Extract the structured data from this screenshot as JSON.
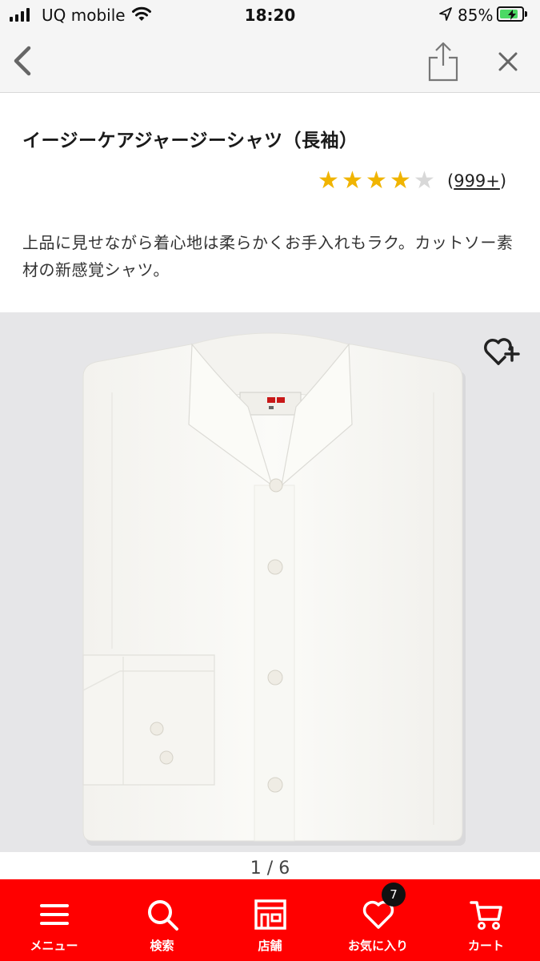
{
  "status_bar": {
    "carrier": "UQ mobile",
    "time": "18:20",
    "battery_percent": "85%",
    "battery_level": 0.85,
    "icons": [
      "signal-icon",
      "wifi-icon",
      "location-arrow-icon",
      "battery-charging-icon"
    ]
  },
  "nav": {
    "icons": [
      "back-chevron-icon",
      "share-icon",
      "close-icon"
    ]
  },
  "product": {
    "title": "イージーケアジャージーシャツ（長袖）",
    "rating_value": 4,
    "rating_max": 5,
    "review_count_open": "(",
    "review_count": "999+",
    "review_count_close": ")",
    "description": "上品に見せながら着心地は柔らかくお手入れもラク。カットソー素材の新感覚シャツ。"
  },
  "gallery": {
    "pager": "1 / 6",
    "current": 1,
    "total": 6,
    "image_subject": "white-dress-shirt-photo",
    "favorite_icon": "heart-plus-icon"
  },
  "tab_bar": {
    "items": [
      {
        "label": "メニュー",
        "icon": "menu-icon"
      },
      {
        "label": "検索",
        "icon": "search-icon"
      },
      {
        "label": "店舗",
        "icon": "store-icon"
      },
      {
        "label": "お気に入り",
        "icon": "heart-icon",
        "badge": "7"
      },
      {
        "label": "カート",
        "icon": "cart-icon"
      }
    ]
  },
  "colors": {
    "brand_red": "#ff0000",
    "star_filled": "#f0b400",
    "star_empty": "#d8d8d8"
  }
}
